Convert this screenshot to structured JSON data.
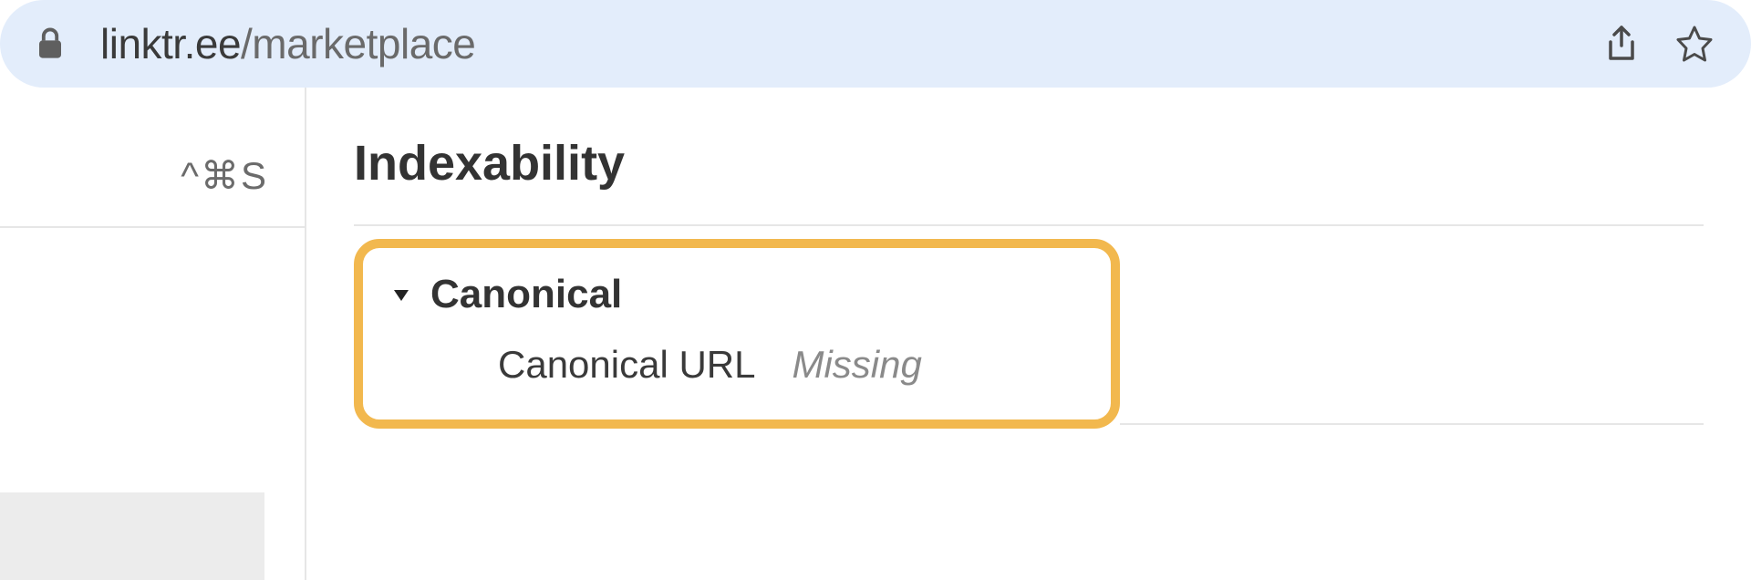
{
  "addressBar": {
    "urlDomain": "linktr.ee",
    "urlPath": "/marketplace",
    "icons": {
      "lock": "lock-icon",
      "share": "share-icon",
      "star": "star-icon"
    }
  },
  "sidebar": {
    "shortcut": "^⌘S"
  },
  "main": {
    "sectionTitle": "Indexability",
    "group": {
      "title": "Canonical",
      "expanded": true,
      "rows": [
        {
          "label": "Canonical URL",
          "value": "Missing"
        }
      ]
    }
  },
  "colors": {
    "highlight": "#f2b84e",
    "addressBarBg": "#e3edfb"
  }
}
